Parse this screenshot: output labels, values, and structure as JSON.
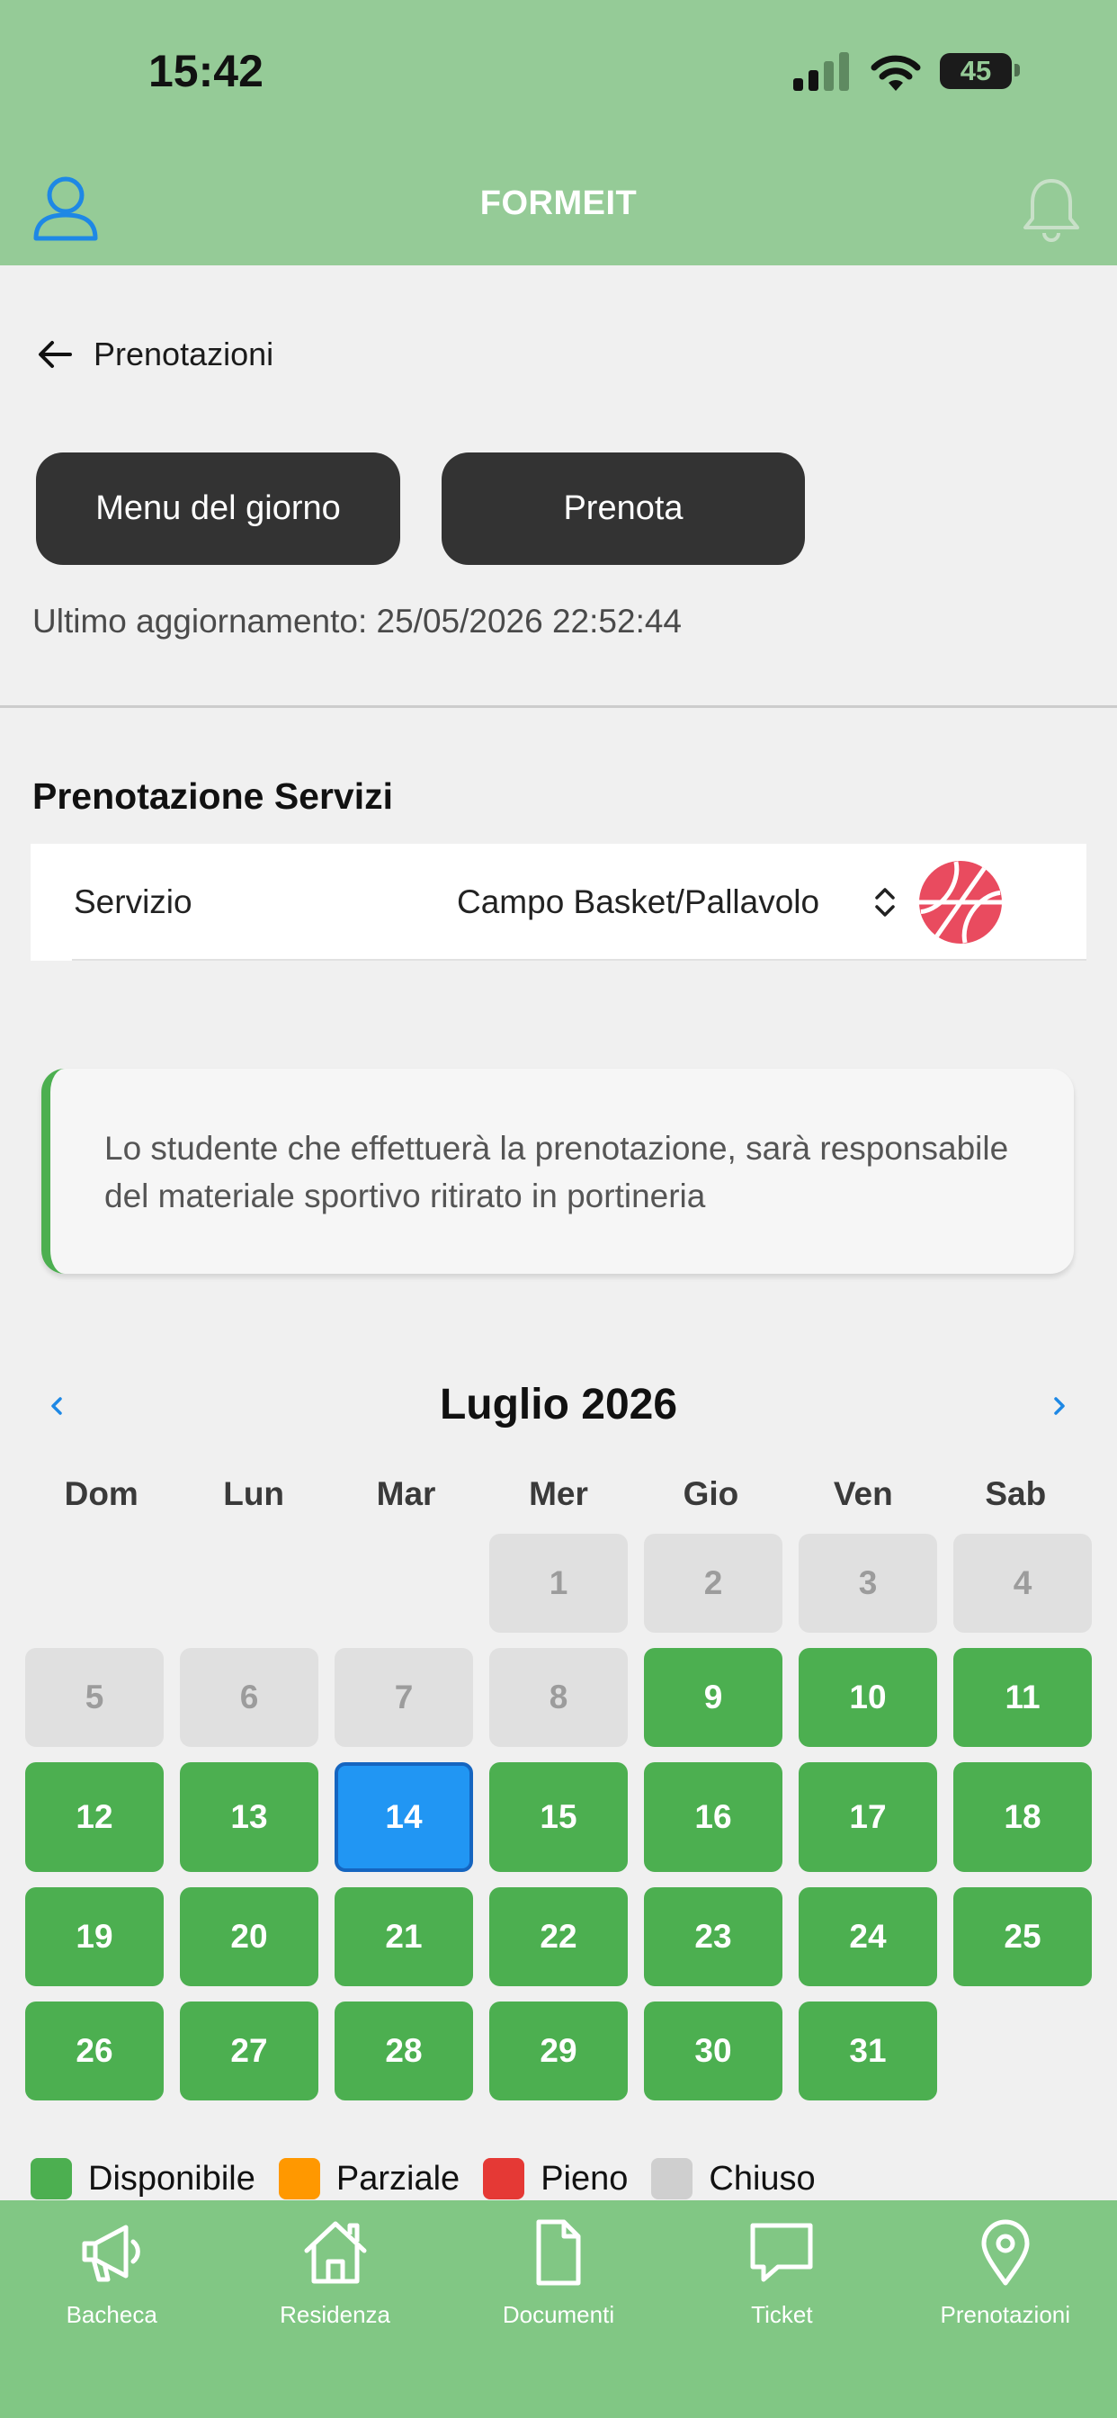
{
  "status_bar": {
    "time": "15:42",
    "battery": "45"
  },
  "header": {
    "title": "FORMEIT"
  },
  "nav_back": {
    "label": "Prenotazioni"
  },
  "actions": {
    "menu_label": "Menu del giorno",
    "prenota_label": "Prenota"
  },
  "last_update": "Ultimo aggiornamento: 25/05/2026 22:52:44",
  "booking": {
    "section_title": "Prenotazione Servizi",
    "service_label": "Servizio",
    "service_value": "Campo Basket/Pallavolo"
  },
  "info_message": "Lo studente che effettuerà la prenotazione, sarà responsabile del materiale sportivo ritirato in portineria",
  "calendar": {
    "title": "Luglio 2026",
    "weekdays": [
      "Dom",
      "Lun",
      "Mar",
      "Mer",
      "Gio",
      "Ven",
      "Sab"
    ],
    "first_weekday_index": 3,
    "days": [
      {
        "day": "1",
        "status": "closed"
      },
      {
        "day": "2",
        "status": "closed"
      },
      {
        "day": "3",
        "status": "closed"
      },
      {
        "day": "4",
        "status": "closed"
      },
      {
        "day": "5",
        "status": "closed"
      },
      {
        "day": "6",
        "status": "closed"
      },
      {
        "day": "7",
        "status": "closed"
      },
      {
        "day": "8",
        "status": "closed"
      },
      {
        "day": "9",
        "status": "available"
      },
      {
        "day": "10",
        "status": "available"
      },
      {
        "day": "11",
        "status": "available"
      },
      {
        "day": "12",
        "status": "available"
      },
      {
        "day": "13",
        "status": "available"
      },
      {
        "day": "14",
        "status": "selected"
      },
      {
        "day": "15",
        "status": "available"
      },
      {
        "day": "16",
        "status": "available"
      },
      {
        "day": "17",
        "status": "available"
      },
      {
        "day": "18",
        "status": "available"
      },
      {
        "day": "19",
        "status": "available"
      },
      {
        "day": "20",
        "status": "available"
      },
      {
        "day": "21",
        "status": "available"
      },
      {
        "day": "22",
        "status": "available"
      },
      {
        "day": "23",
        "status": "available"
      },
      {
        "day": "24",
        "status": "available"
      },
      {
        "day": "25",
        "status": "available"
      },
      {
        "day": "26",
        "status": "available"
      },
      {
        "day": "27",
        "status": "available"
      },
      {
        "day": "28",
        "status": "available"
      },
      {
        "day": "29",
        "status": "available"
      },
      {
        "day": "30",
        "status": "available"
      },
      {
        "day": "31",
        "status": "available"
      }
    ]
  },
  "legend": [
    {
      "label": "Disponibile",
      "color": "#4caf50"
    },
    {
      "label": "Parziale",
      "color": "#ff9800"
    },
    {
      "label": "Pieno",
      "color": "#e53935"
    },
    {
      "label": "Chiuso",
      "color": "#cfcfcf"
    }
  ],
  "bottom_nav": [
    {
      "label": "Bacheca",
      "icon": "megaphone-icon"
    },
    {
      "label": "Residenza",
      "icon": "home-icon"
    },
    {
      "label": "Documenti",
      "icon": "document-icon"
    },
    {
      "label": "Ticket",
      "icon": "chat-icon"
    },
    {
      "label": "Prenotazioni",
      "icon": "location-pin-icon"
    }
  ]
}
